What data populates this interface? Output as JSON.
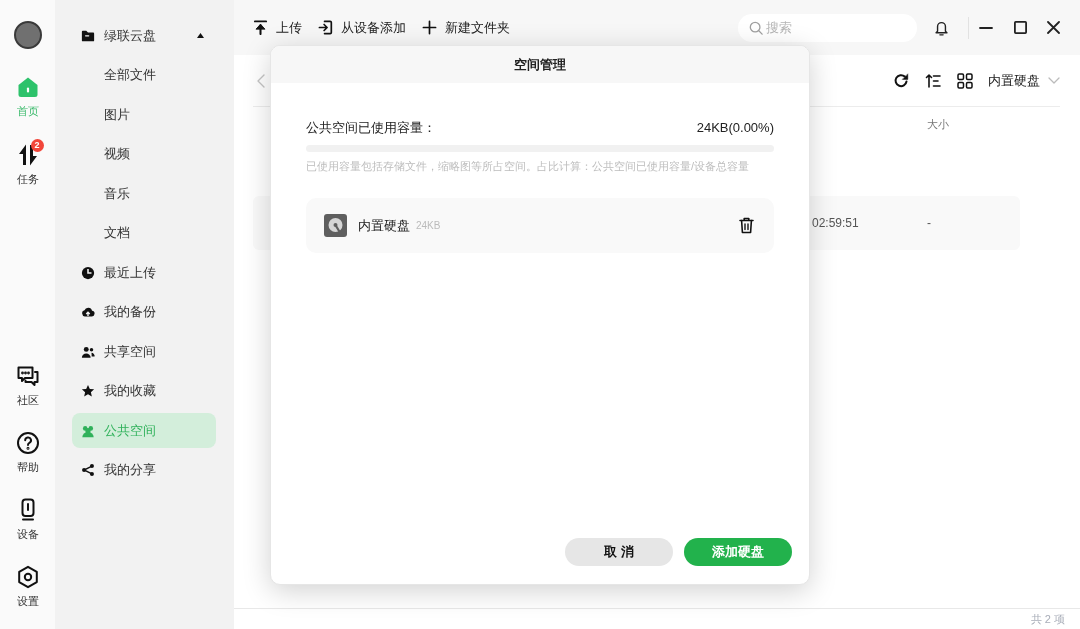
{
  "rail": {
    "top": [
      {
        "label": "首页",
        "kind": "home",
        "selected": true
      },
      {
        "label": "任务",
        "kind": "tasks",
        "selected": false,
        "badge": "2"
      }
    ],
    "bottom": [
      {
        "label": "社区",
        "kind": "community",
        "selected": false
      },
      {
        "label": "帮助",
        "kind": "help",
        "selected": false
      },
      {
        "label": "设备",
        "kind": "device",
        "selected": false
      },
      {
        "label": "设置",
        "kind": "settings",
        "selected": false
      }
    ]
  },
  "sidebar": {
    "items": [
      {
        "label": "绿联云盘",
        "kind": "folder",
        "selected": false,
        "expanded": true,
        "children": [
          {
            "label": "全部文件",
            "selected": false
          },
          {
            "label": "图片",
            "selected": false
          },
          {
            "label": "视频",
            "selected": false
          },
          {
            "label": "音乐",
            "selected": false
          },
          {
            "label": "文档",
            "selected": false
          }
        ]
      },
      {
        "label": "最近上传",
        "kind": "clock",
        "selected": false
      },
      {
        "label": "我的备份",
        "kind": "cloud",
        "selected": false
      },
      {
        "label": "共享空间",
        "kind": "users",
        "selected": false
      },
      {
        "label": "我的收藏",
        "kind": "star",
        "selected": false
      },
      {
        "label": "公共空间",
        "kind": "group",
        "selected": true
      },
      {
        "label": "我的分享",
        "kind": "share",
        "selected": false
      }
    ]
  },
  "toolbar": {
    "actions": [
      {
        "label": "上传",
        "kind": "upload"
      },
      {
        "label": "从设备添加",
        "kind": "import"
      },
      {
        "label": "新建文件夹",
        "kind": "new-folder"
      }
    ],
    "search": {
      "placeholder": "搜索"
    }
  },
  "file_view": {
    "location": "内置硬盘",
    "table": {
      "columns": [
        "",
        "大小"
      ],
      "rows": [
        [
          "02:59:51",
          "-"
        ]
      ]
    },
    "status": "共 2 项"
  },
  "dialog": {
    "title": "空间管理",
    "usage": {
      "label": "公共空间已使用容量：",
      "reading": "24KB(0.00%)",
      "level": 0
    },
    "note": "已使用容量包括存储文件，缩略图等所占空间。占比计算：公共空间已使用容量/设备总容量",
    "disks": [
      {
        "name": "内置硬盘",
        "size": "24KB"
      }
    ],
    "buttons": [
      {
        "label": "取 消",
        "kind": "secondary"
      },
      {
        "label": "添加硬盘",
        "kind": "primary"
      }
    ]
  }
}
